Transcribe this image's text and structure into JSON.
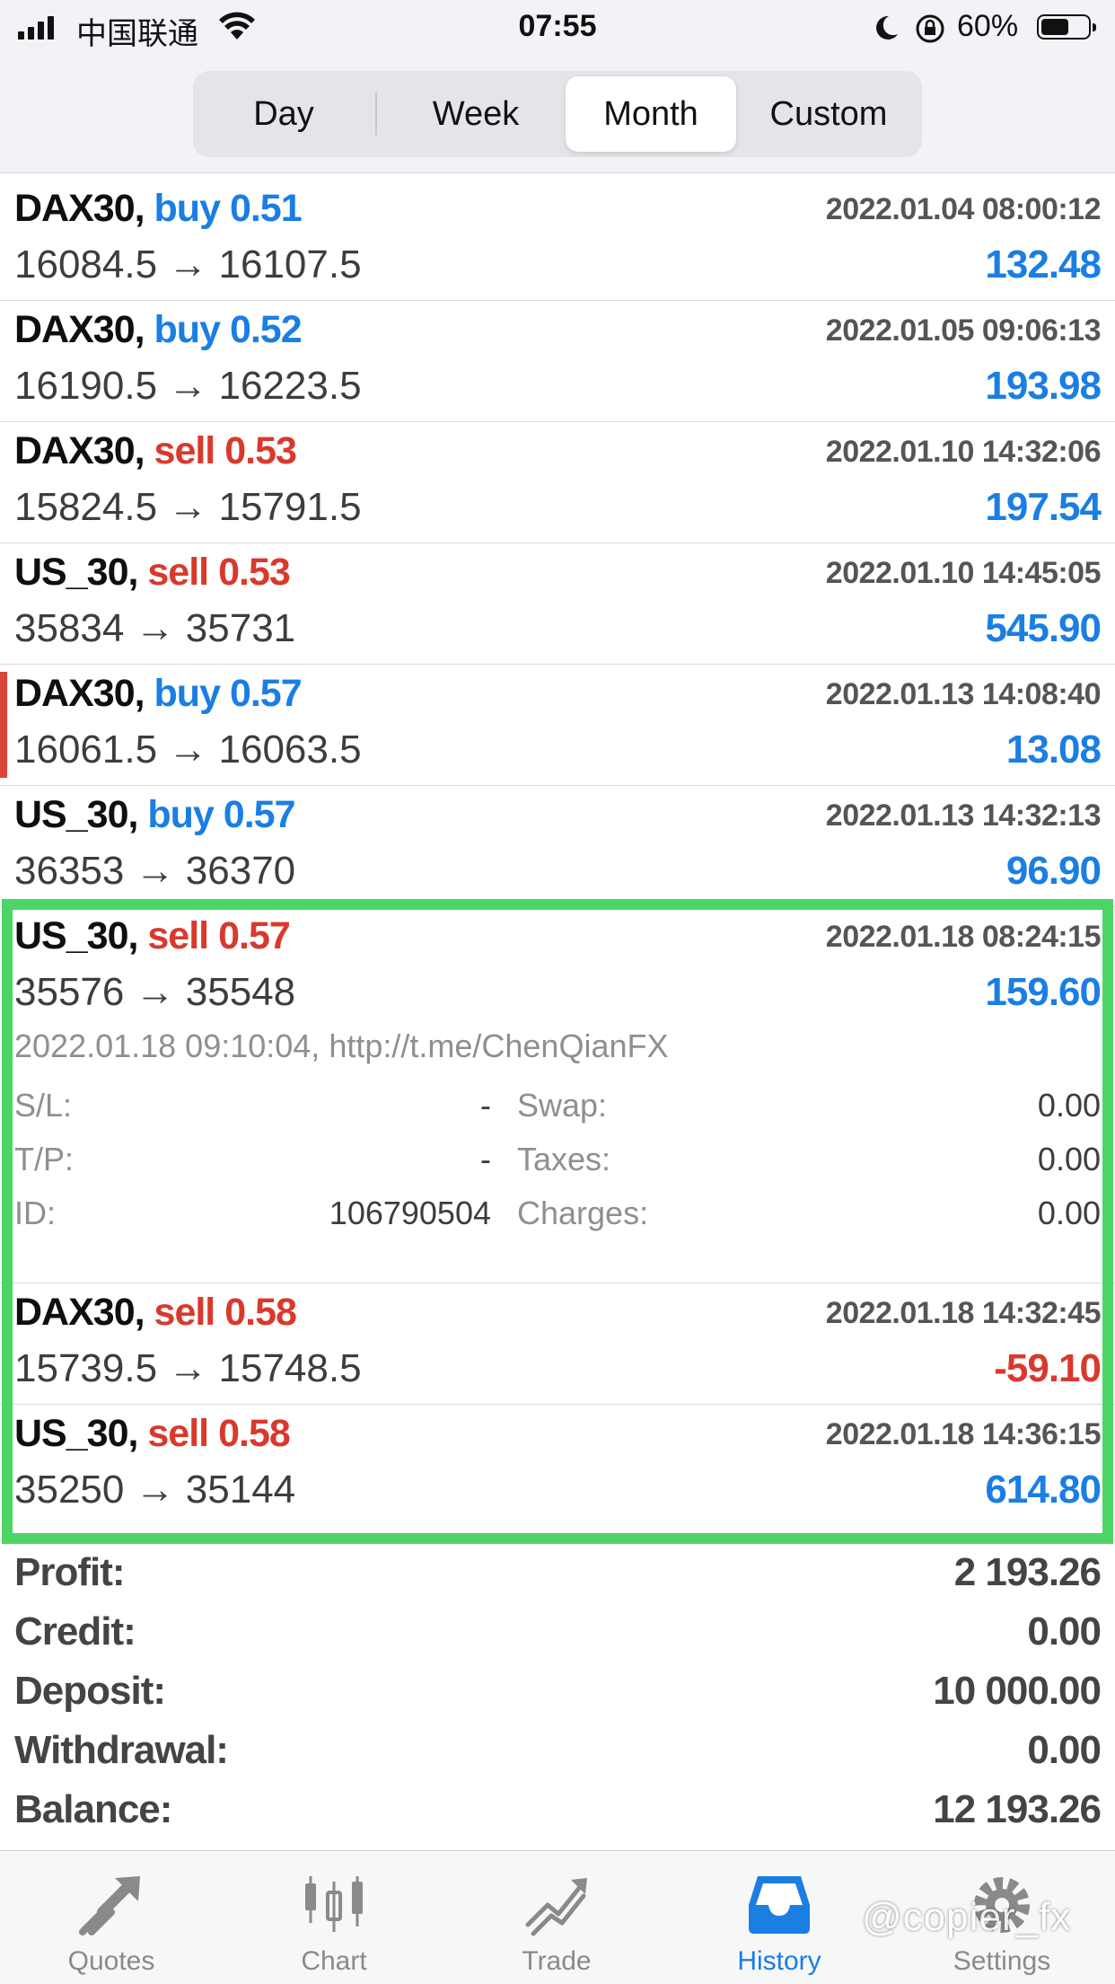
{
  "status_bar": {
    "carrier": "中国联通",
    "time": "07:55",
    "battery_percent": "60%",
    "battery_level": 0.6
  },
  "periods": {
    "items": [
      "Day",
      "Week",
      "Month",
      "Custom"
    ],
    "selected": "Month"
  },
  "deals": [
    {
      "symbol": "DAX30,",
      "side": "buy",
      "volume": "0.51",
      "time": "2022.01.04 08:00:12",
      "prices": "16084.5 → 16107.5",
      "profit": "132.48"
    },
    {
      "symbol": "DAX30,",
      "side": "buy",
      "volume": "0.52",
      "time": "2022.01.05 09:06:13",
      "prices": "16190.5 → 16223.5",
      "profit": "193.98"
    },
    {
      "symbol": "DAX30,",
      "side": "sell",
      "volume": "0.53",
      "time": "2022.01.10 14:32:06",
      "prices": "15824.5 → 15791.5",
      "profit": "197.54"
    },
    {
      "symbol": "US_30,",
      "side": "sell",
      "volume": "0.53",
      "time": "2022.01.10 14:45:05",
      "prices": "35834 → 35731",
      "profit": "545.90"
    },
    {
      "symbol": "DAX30,",
      "side": "buy",
      "volume": "0.57",
      "time": "2022.01.13 14:08:40",
      "prices": "16061.5 → 16063.5",
      "profit": "13.08"
    },
    {
      "symbol": "US_30,",
      "side": "buy",
      "volume": "0.57",
      "time": "2022.01.13 14:32:13",
      "prices": "36353 → 36370",
      "profit": "96.90"
    },
    {
      "symbol": "US_30,",
      "side": "sell",
      "volume": "0.57",
      "time": "2022.01.18 08:24:15",
      "prices": "35576 → 35548",
      "profit": "159.60"
    },
    {
      "symbol": "DAX30,",
      "side": "sell",
      "volume": "0.58",
      "time": "2022.01.18 14:32:45",
      "prices": "15739.5 → 15748.5",
      "profit": "-59.10"
    },
    {
      "symbol": "US_30,",
      "side": "sell",
      "volume": "0.58",
      "time": "2022.01.18 14:36:15",
      "prices": "35250 → 35144",
      "profit": "614.80"
    }
  ],
  "details": {
    "comment": "2022.01.18 09:10:04, http://t.me/ChenQianFX",
    "sl_label": "S/L:",
    "sl_value": "-",
    "tp_label": "T/P:",
    "tp_value": "-",
    "id_label": "ID:",
    "id_value": "106790504",
    "swap_label": "Swap:",
    "swap_value": "0.00",
    "taxes_label": "Taxes:",
    "taxes_value": "0.00",
    "charges_label": "Charges:",
    "charges_value": "0.00"
  },
  "summary": {
    "profit_label": "Profit:",
    "profit_value": "2 193.26",
    "credit_label": "Credit:",
    "credit_value": "0.00",
    "deposit_label": "Deposit:",
    "deposit_value": "10 000.00",
    "withdrawal_label": "Withdrawal:",
    "withdrawal_value": "0.00",
    "balance_label": "Balance:",
    "balance_value": "12 193.26"
  },
  "tabs": [
    {
      "label": "Quotes",
      "icon": "quotes-icon"
    },
    {
      "label": "Chart",
      "icon": "candlestick-icon"
    },
    {
      "label": "Trade",
      "icon": "trade-icon"
    },
    {
      "label": "History",
      "icon": "history-inbox-icon"
    },
    {
      "label": "Settings",
      "icon": "gear-icon"
    }
  ],
  "active_tab": "History",
  "watermark": "@copier_fx",
  "colors": {
    "buy": "#1a7ee3",
    "sell": "#d9392d",
    "profit_positive": "#1a7ee3",
    "profit_negative": "#d9392d",
    "highlight": "#4cd564",
    "active_tab": "#1a7ee3"
  }
}
